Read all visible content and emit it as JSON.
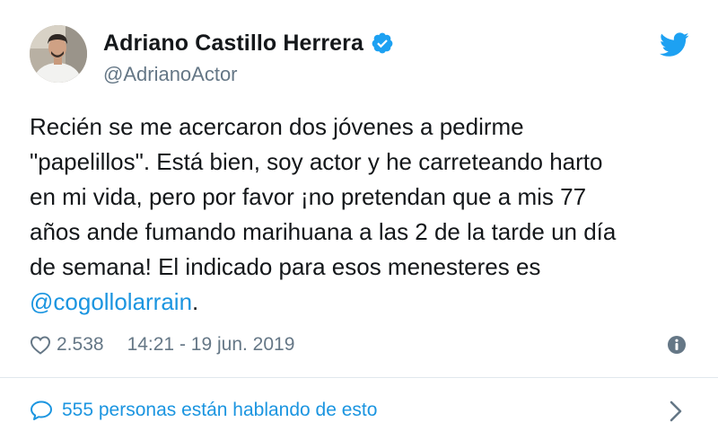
{
  "author": {
    "display_name": "Adriano Castillo Herrera",
    "handle": "@AdrianoActor",
    "verified": true
  },
  "tweet": {
    "lines": [
      "Recién se me acercaron dos jóvenes a pedirme",
      "\"papelillos\". Está bien, soy actor y he carreteando harto",
      "en mi vida, pero por favor ¡no pretendan que a mis 77",
      "años ande fumando marihuana a las 2 de la tarde un día",
      "de semana! El indicado para esos menesteres es"
    ],
    "mention": "@cogollolarrain",
    "mention_suffix": "."
  },
  "meta": {
    "like_count": "2.538",
    "timestamp": "14:21 - 19 jun. 2019"
  },
  "conversation": {
    "label": "555 personas están hablando de esto"
  },
  "icons": {
    "brand": "twitter-bird-icon",
    "verified": "verified-badge-icon",
    "like": "heart-icon",
    "info": "info-icon",
    "conversation": "speech-bubble-icon",
    "next": "chevron-right-icon"
  },
  "colors": {
    "brand_blue": "#1da1f2",
    "link_blue": "#1b95e0",
    "text": "#14171a",
    "muted": "#657786",
    "divider": "#e1e8ed"
  }
}
